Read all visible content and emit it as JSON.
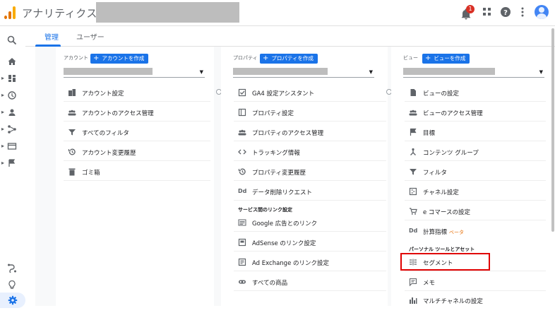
{
  "header": {
    "app_title": "アナリティクス",
    "notification_count": "1",
    "icons": [
      "bell-icon",
      "apps-grid-icon",
      "help-icon",
      "more-vert-icon",
      "avatar"
    ]
  },
  "tabs": [
    {
      "label": "管理",
      "active": true
    },
    {
      "label": "ユーザー",
      "active": false
    }
  ],
  "left_rail": [
    "search-icon",
    "home-icon",
    "dashboard-icon",
    "clock-icon",
    "person-icon",
    "acquisition-icon",
    "behavior-icon",
    "flag-icon",
    "connect-icon",
    "lightbulb-icon",
    "settings-icon"
  ],
  "columns": {
    "account": {
      "heading": "アカウント",
      "create_label": "アカウントを作成",
      "items": [
        {
          "icon": "building-icon",
          "label": "アカウント設定"
        },
        {
          "icon": "people-icon",
          "label": "アカウントのアクセス管理"
        },
        {
          "icon": "filter-icon",
          "label": "すべてのフィルタ"
        },
        {
          "icon": "history-icon",
          "label": "アカウント変更履歴"
        },
        {
          "icon": "trash-icon",
          "label": "ゴミ箱"
        }
      ]
    },
    "property": {
      "heading": "プロパティ",
      "create_label": "プロパティを作成",
      "items": [
        {
          "icon": "checkbox-icon",
          "label": "GA4 設定アシスタント"
        },
        {
          "icon": "square-icon",
          "label": "プロパティ設定"
        },
        {
          "icon": "people-icon",
          "label": "プロパティのアクセス管理"
        },
        {
          "icon": "code-icon",
          "label": "トラッキング情報"
        },
        {
          "icon": "history-icon",
          "label": "プロパティ変更履歴"
        },
        {
          "icon": "dd-icon",
          "label": "データ削除リクエスト"
        }
      ],
      "section_label": "サービス間のリンク設定",
      "link_items": [
        {
          "icon": "google-ads-icon",
          "label": "Google 広告とのリンク"
        },
        {
          "icon": "adsense-icon",
          "label": "AdSense のリンク設定"
        },
        {
          "icon": "adexchange-icon",
          "label": "Ad Exchange のリンク設定"
        },
        {
          "icon": "link-icon",
          "label": "すべての商品"
        }
      ]
    },
    "view": {
      "heading": "ビュー",
      "create_label": "ビューを作成",
      "items": [
        {
          "icon": "document-icon",
          "label": "ビューの設定"
        },
        {
          "icon": "people-icon",
          "label": "ビューのアクセス管理"
        },
        {
          "icon": "flag-icon",
          "label": "目標"
        },
        {
          "icon": "content-group-icon",
          "label": "コンテンツ グループ"
        },
        {
          "icon": "filter-icon",
          "label": "フィルタ"
        },
        {
          "icon": "channel-icon",
          "label": "チャネル設定"
        },
        {
          "icon": "cart-icon",
          "label": "e コマースの設定"
        },
        {
          "icon": "dd-icon",
          "label": "計算指標",
          "badge": "ベータ"
        }
      ],
      "section_label": "パーソナル ツールとアセット",
      "tool_items": [
        {
          "icon": "segment-icon",
          "label": "セグメント"
        },
        {
          "icon": "comment-icon",
          "label": "メモ"
        },
        {
          "icon": "bar-chart-icon",
          "label": "マルチチャネルの設定"
        }
      ]
    }
  }
}
